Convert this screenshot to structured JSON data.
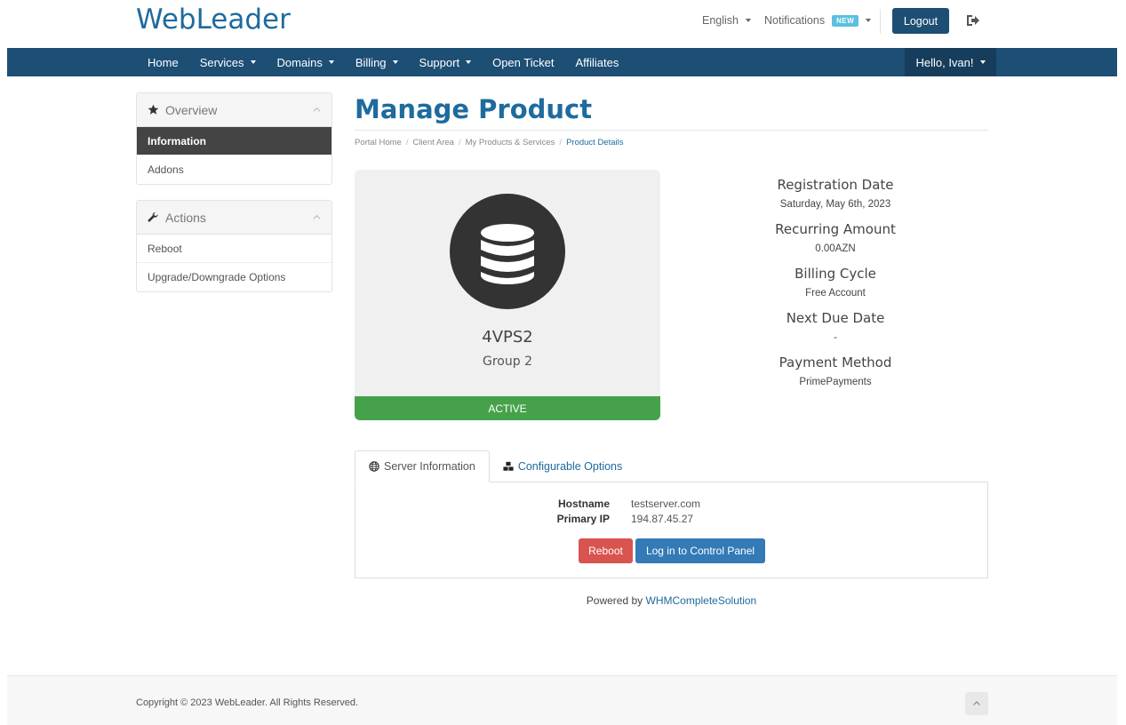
{
  "header": {
    "logo": "WebLeader",
    "language": "English",
    "notifications": "Notifications",
    "new_badge": "NEW",
    "logout": "Logout",
    "logout_icon": "sign-out-icon"
  },
  "nav": {
    "items": [
      {
        "label": "Home",
        "dropdown": false
      },
      {
        "label": "Services",
        "dropdown": true
      },
      {
        "label": "Domains",
        "dropdown": true
      },
      {
        "label": "Billing",
        "dropdown": true
      },
      {
        "label": "Support",
        "dropdown": true
      },
      {
        "label": "Open Ticket",
        "dropdown": false
      },
      {
        "label": "Affiliates",
        "dropdown": false
      }
    ],
    "user": "Hello, Ivan!"
  },
  "sidebar": {
    "overview": {
      "title": "Overview",
      "icon": "star-icon",
      "items": [
        "Information",
        "Addons"
      ],
      "active": "Information"
    },
    "actions": {
      "title": "Actions",
      "icon": "wrench-icon",
      "items": [
        "Reboot",
        "Upgrade/Downgrade Options"
      ]
    }
  },
  "main": {
    "title": "Manage Product",
    "breadcrumb": [
      "Portal Home",
      "Client Area",
      "My Products & Services",
      "Product Details"
    ],
    "product": {
      "icon": "database-icon",
      "name": "4VPS2",
      "group": "Group 2",
      "status": "ACTIVE"
    },
    "details": [
      {
        "label": "Registration Date",
        "value": "Saturday, May 6th, 2023"
      },
      {
        "label": "Recurring Amount",
        "value": "0.00AZN"
      },
      {
        "label": "Billing Cycle",
        "value": "Free Account"
      },
      {
        "label": "Next Due Date",
        "value": "-"
      },
      {
        "label": "Payment Method",
        "value": "PrimePayments"
      }
    ],
    "tabs": [
      {
        "label": "Server Information",
        "icon": "globe-icon",
        "active": true
      },
      {
        "label": "Configurable Options",
        "icon": "cubes-icon",
        "active": false
      }
    ],
    "server_info": {
      "hostname_label": "Hostname",
      "hostname": "testserver.com",
      "ip_label": "Primary IP",
      "ip": "194.87.45.27"
    },
    "buttons": {
      "reboot": "Reboot",
      "control_panel": "Log in to Control Panel"
    },
    "powered_prefix": "Powered by",
    "powered_link": "WHMCompleteSolution"
  },
  "footer": {
    "copyright": "Copyright © 2023 WebLeader. All Rights Reserved."
  },
  "colors": {
    "brand_blue": "#1d4e74",
    "link_blue": "#1e6b9e",
    "active_green": "#46a24a",
    "danger_red": "#d9534f",
    "primary_blue": "#337ab7"
  }
}
